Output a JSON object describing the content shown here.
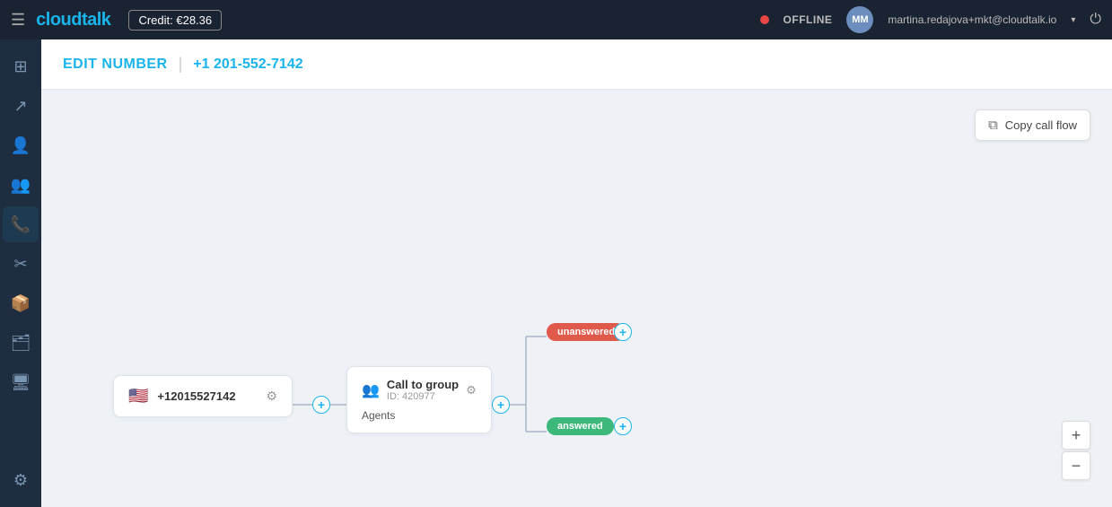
{
  "topnav": {
    "hamburger_icon": "☰",
    "logo_text": "cloudtalk",
    "credit_label": "Credit:",
    "credit_value": "€28.36",
    "status_label": "OFFLINE",
    "user_initials": "MM",
    "user_email": "martina.redajova+mkt@cloudtalk.io",
    "power_icon": "⏻"
  },
  "sidebar": {
    "items": [
      {
        "icon": "⊞",
        "name": "dashboard",
        "active": false
      },
      {
        "icon": "↗",
        "name": "analytics",
        "active": false
      },
      {
        "icon": "👤",
        "name": "contacts",
        "active": false
      },
      {
        "icon": "👥",
        "name": "teams",
        "active": false
      },
      {
        "icon": "📞",
        "name": "phone",
        "active": true
      },
      {
        "icon": "✂",
        "name": "tools",
        "active": false
      },
      {
        "icon": "📦",
        "name": "integrations",
        "active": false
      },
      {
        "icon": "🗂",
        "name": "records",
        "active": false
      },
      {
        "icon": "🖥",
        "name": "monitor",
        "active": false
      }
    ],
    "bottom_items": [
      {
        "icon": "⚙",
        "name": "settings"
      }
    ]
  },
  "header": {
    "edit_label": "EDIT NUMBER",
    "divider": "|",
    "phone_number": "+1 201-552-7142"
  },
  "toolbar": {
    "copy_callflow_icon": "⧉",
    "copy_callflow_label": "Copy call flow"
  },
  "flow": {
    "phone_node": {
      "flag": "🇺🇸",
      "number": "+12015527142",
      "settings_icon": "⚙"
    },
    "call_group_node": {
      "group_icon": "👥",
      "title": "Call to group",
      "id": "ID: 420977",
      "sub": "Agents",
      "settings_icon": "⚙"
    },
    "badge_unanswered": "unanswered",
    "badge_answered": "answered",
    "add_icon": "+"
  },
  "zoom": {
    "plus": "+",
    "minus": "−"
  }
}
